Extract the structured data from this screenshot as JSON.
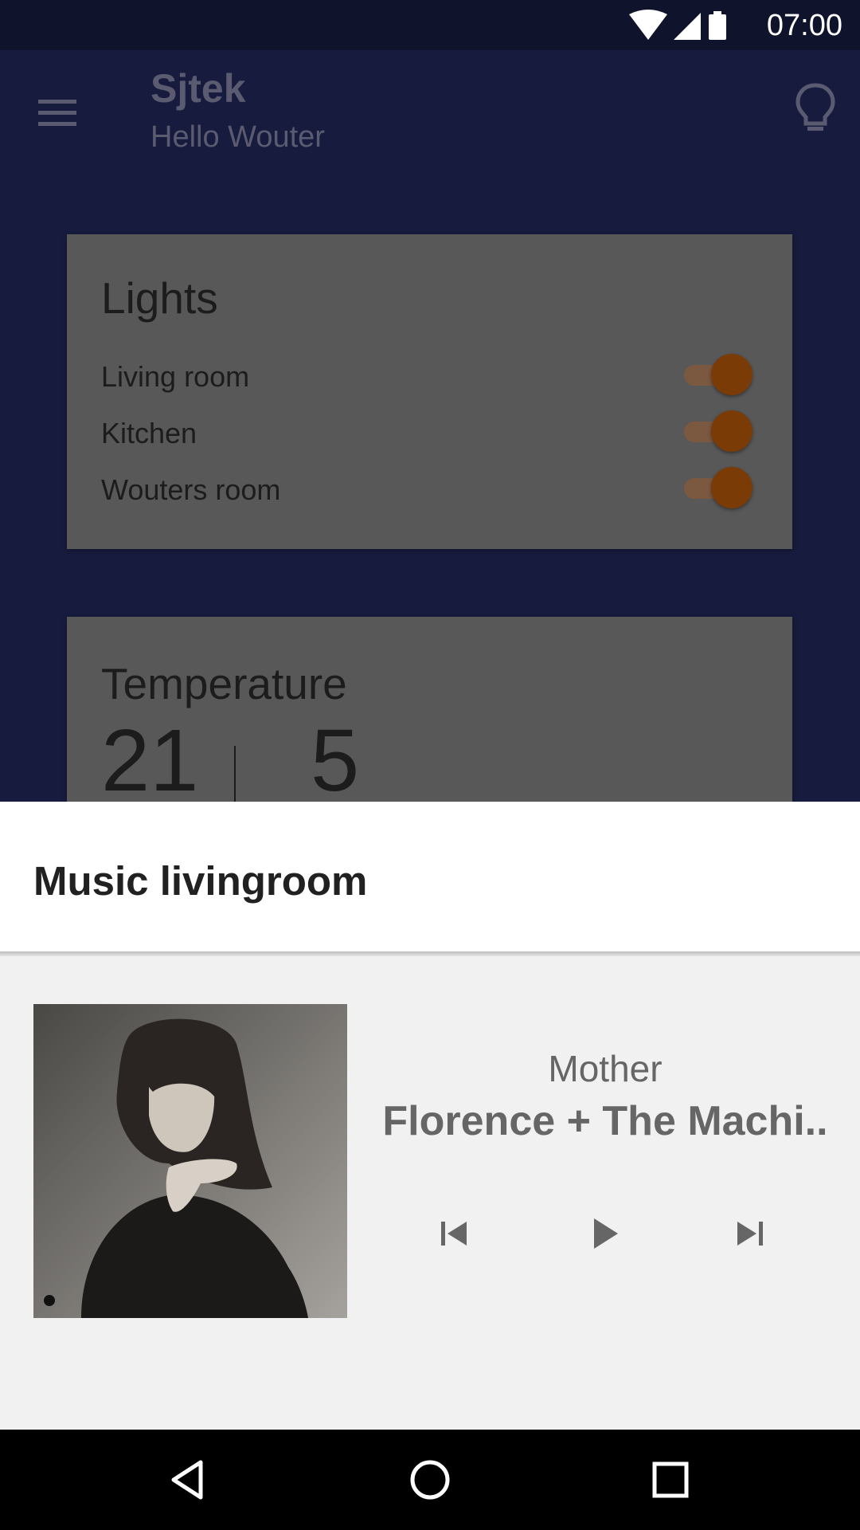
{
  "status_bar": {
    "time": "07:00",
    "icons": [
      "wifi-icon",
      "signal-icon",
      "battery-icon"
    ]
  },
  "app_bar": {
    "title": "Sjtek",
    "subtitle": "Hello Wouter",
    "menu_icon": "menu-icon",
    "action_icon": "lightbulb-icon"
  },
  "lights_card": {
    "title": "Lights",
    "items": [
      {
        "label": "Living room",
        "on": true
      },
      {
        "label": "Kitchen",
        "on": true
      },
      {
        "label": "Wouters room",
        "on": true
      }
    ]
  },
  "temperature_card": {
    "title": "Temperature",
    "inside": "21",
    "outside": "5"
  },
  "music_sheet": {
    "title": "Music livingroom",
    "track_title": "Mother",
    "artist": "Florence + The Machi..",
    "controls": [
      "skip-previous-icon",
      "play-icon",
      "skip-next-icon"
    ]
  },
  "colors": {
    "accent": "#7a3b06",
    "background_dim": "#171c3e",
    "sheet_header": "#ffffff",
    "sheet_body": "#f1f1f1"
  },
  "nav_bar": {
    "buttons": [
      "back-icon",
      "home-icon",
      "recents-icon"
    ]
  }
}
